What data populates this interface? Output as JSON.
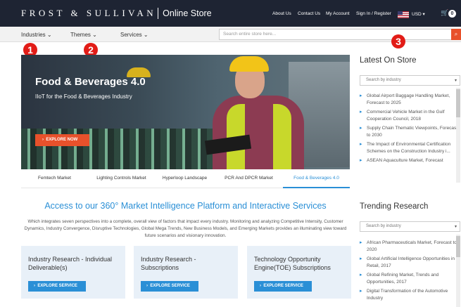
{
  "header": {
    "brand": "FROST & SULLIVAN",
    "store": "Online Store",
    "links": [
      "About Us",
      "Contact Us",
      "My Account",
      "Sign In / Register"
    ],
    "currency": "USD",
    "cart_count": "0"
  },
  "nav": {
    "items": [
      "Industries",
      "Themes",
      "Services"
    ],
    "search_placeholder": "Search entire store here..."
  },
  "annotations": [
    "1",
    "2",
    "3"
  ],
  "hero": {
    "title": "Food & Beverages 4.0",
    "subtitle": "IIoT for the Food & Beverages Industry",
    "cta": "EXPLORE NOW"
  },
  "tabs": [
    "Femtech Market",
    "Lighting Controls Market",
    "Hyperloop Landscape",
    "PCR And DPCR Market",
    "Food & Beverages 4.0"
  ],
  "access": {
    "title": "Access to our 360° Market Intelligence Platform and Interactive Services",
    "description": "Which integrates seven perspectives into a complete, overall view of factors that impact every industry. Monitoring and analyzing Competitive Intensity, Customer Dynamics, Industry Convergence, Disruptive Technologies, Global Mega Trends, New Business Models, and Emerging Markets provides an illuminating view toward future scenarios and visionary innovation."
  },
  "cards": [
    {
      "title": "Industry Research - Individual Deliverable(s)",
      "button": "EXPLORE SERVICE"
    },
    {
      "title": "Industry Research - Subscriptions",
      "button": "EXPLORE SERVICE"
    },
    {
      "title": "Technology Opportunity Engine(TOE) Subscriptions",
      "button": "EXPLORE SERVICE"
    }
  ],
  "latest": {
    "title": "Latest On Store",
    "select_placeholder": "Search by industry",
    "items": [
      "Global Airport Baggage Handling Market, Forecast to 2025",
      "Commercial Vehicle Market in the Gulf Cooperation Council, 2018",
      "Supply Chain Thematic Viewpoints, Forecast to 2030",
      "The Impact of Environmental Certification Schemes on the Construction Industry i...",
      "ASEAN Aquaculture Market, Forecast"
    ]
  },
  "trending": {
    "title": "Trending Research",
    "select_placeholder": "Search by industry",
    "items": [
      "African Pharmaceuticals Market, Forecast to 2020",
      "Global Artificial Intelligence Opportunities in Retail, 2017",
      "Global Refining Market, Trends and Opportunities, 2017",
      "Digital Transformation of the Automotive Industry"
    ]
  }
}
